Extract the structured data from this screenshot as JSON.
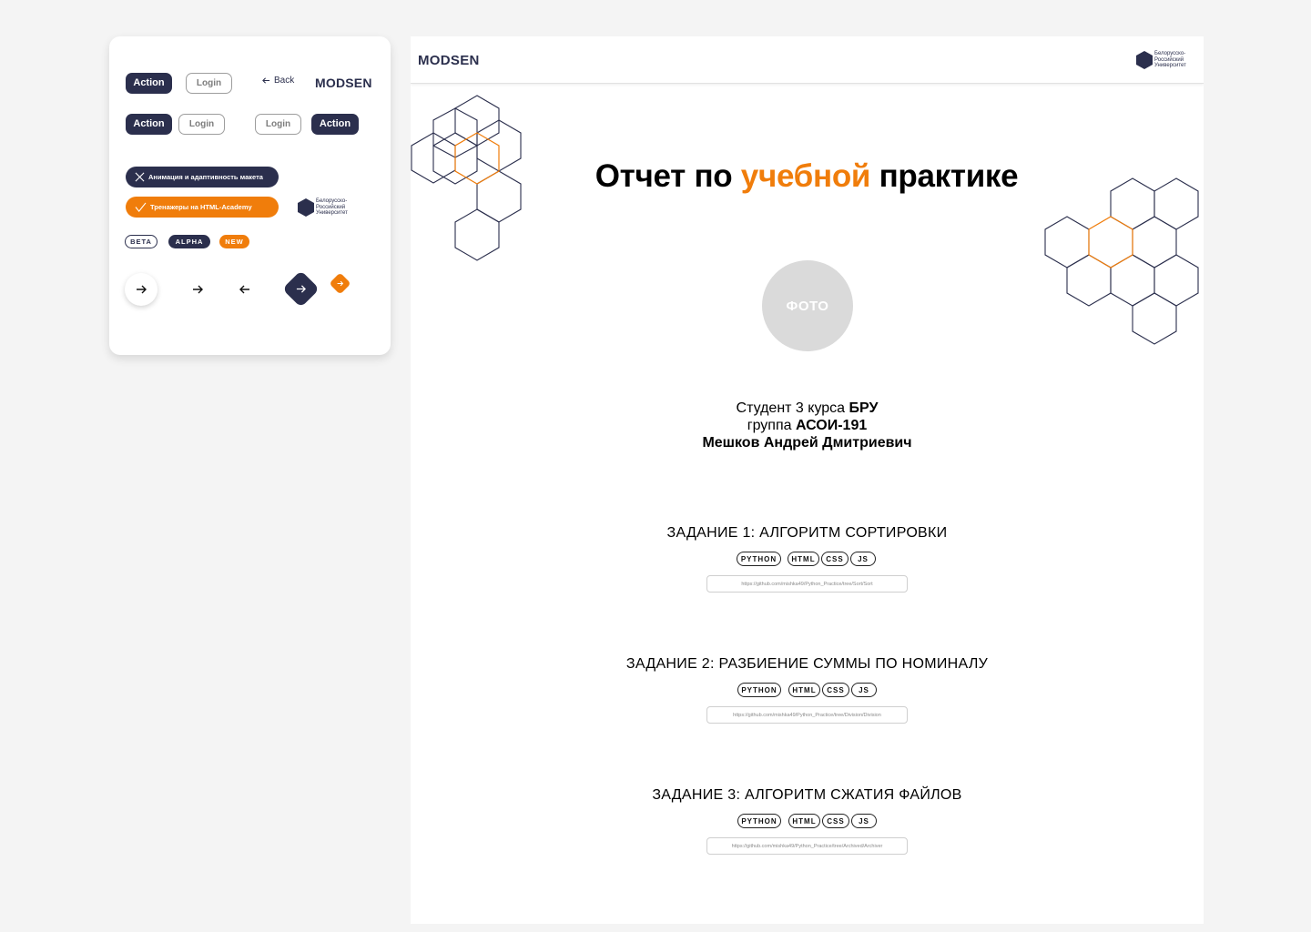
{
  "kit": {
    "action_label": "Action",
    "login_label": "Login",
    "back_label": "Back",
    "logo": "MODSEN",
    "chip_dark": "Анимация и адаптивность макета",
    "chip_orange": "Тренажеры на HTML-Academy",
    "uni_line1": "Белорусско-",
    "uni_line2": "Российский",
    "uni_line3": "Университет",
    "badges": [
      "BETA",
      "ALPHA",
      "NEW"
    ]
  },
  "header": {
    "brand": "MODSEN",
    "uni_line1": "Белорусско-",
    "uni_line2": "Российский",
    "uni_line3": "Университет"
  },
  "report": {
    "title_part1": "Отчет по ",
    "title_accent": "учебной",
    "title_part2": " практике",
    "photo_label": "ФОТО",
    "student_prefix": "Студент 3 курса ",
    "student_university": "БРУ",
    "group_prefix": "группа ",
    "group_name": "АСОИ-191",
    "student_name": "Мешков Андрей Дмитриевич"
  },
  "tasks": [
    {
      "title": "ЗАДАНИЕ 1: АЛГОРИТМ СОРТИРОВКИ",
      "tags": [
        "PYTHON",
        "HTML",
        "CSS",
        "JS"
      ],
      "link": "https://github.com/mishka49/Python_Practice/tree/Sort/Sort"
    },
    {
      "title": "ЗАДАНИЕ 2: РАЗБИЕНИЕ СУММЫ ПО НОМИНАЛУ",
      "tags": [
        "PYTHON",
        "HTML",
        "CSS",
        "JS"
      ],
      "link": "https://github.com/mishka49/Python_Practice/tree/Division/Division"
    },
    {
      "title": "ЗАДАНИЕ 3: АЛГОРИТМ СЖАТИЯ ФАЙЛОВ",
      "tags": [
        "PYTHON",
        "HTML",
        "CSS",
        "JS"
      ],
      "link": "https://github.com/mishka49/Python_Practice/tree/Archived/Archiver"
    }
  ],
  "colors": {
    "navy": "#2b2f4d",
    "orange": "#f07d0b",
    "photo_gray": "#dadada"
  }
}
